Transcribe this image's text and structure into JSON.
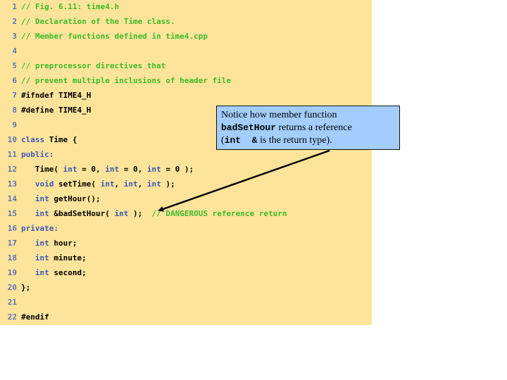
{
  "code_listing": {
    "lines": [
      {
        "n": "1",
        "parts": [
          {
            "t": "// Fig. 6.11: time4.h",
            "c": "cm"
          }
        ]
      },
      {
        "n": "2",
        "parts": [
          {
            "t": "// Declaration of the Time class.",
            "c": "cm"
          }
        ]
      },
      {
        "n": "3",
        "parts": [
          {
            "t": "// Member functions defined in time4.cpp",
            "c": "cm"
          }
        ]
      },
      {
        "n": "4",
        "parts": []
      },
      {
        "n": "5",
        "parts": [
          {
            "t": "// preprocessor directives that",
            "c": "cm"
          }
        ]
      },
      {
        "n": "6",
        "parts": [
          {
            "t": "// prevent multiple inclusions of header file",
            "c": "cm"
          }
        ]
      },
      {
        "n": "7",
        "parts": [
          {
            "t": "#ifndef TIME4_H",
            "c": "tx"
          }
        ]
      },
      {
        "n": "8",
        "parts": [
          {
            "t": "#define TIME4_H",
            "c": "tx"
          }
        ]
      },
      {
        "n": "9",
        "parts": []
      },
      {
        "n": "10",
        "parts": [
          {
            "t": "class",
            "c": "kw"
          },
          {
            "t": " Time {",
            "c": "tx"
          }
        ]
      },
      {
        "n": "11",
        "parts": [
          {
            "t": "public:",
            "c": "kw"
          }
        ]
      },
      {
        "n": "12",
        "parts": [
          {
            "t": "   Time( ",
            "c": "tx"
          },
          {
            "t": "int",
            "c": "kw"
          },
          {
            "t": " = 0, ",
            "c": "tx"
          },
          {
            "t": "int",
            "c": "kw"
          },
          {
            "t": " = 0, ",
            "c": "tx"
          },
          {
            "t": "int",
            "c": "kw"
          },
          {
            "t": " = 0 );",
            "c": "tx"
          }
        ]
      },
      {
        "n": "13",
        "parts": [
          {
            "t": "   ",
            "c": "tx"
          },
          {
            "t": "void",
            "c": "kw"
          },
          {
            "t": " setTime( ",
            "c": "tx"
          },
          {
            "t": "int",
            "c": "kw"
          },
          {
            "t": ", ",
            "c": "tx"
          },
          {
            "t": "int",
            "c": "kw"
          },
          {
            "t": ", ",
            "c": "tx"
          },
          {
            "t": "int",
            "c": "kw"
          },
          {
            "t": " );",
            "c": "tx"
          }
        ]
      },
      {
        "n": "14",
        "parts": [
          {
            "t": "   ",
            "c": "tx"
          },
          {
            "t": "int",
            "c": "kw"
          },
          {
            "t": " getHour();",
            "c": "tx"
          }
        ]
      },
      {
        "n": "15",
        "parts": [
          {
            "t": "   ",
            "c": "tx"
          },
          {
            "t": "int",
            "c": "kw"
          },
          {
            "t": " &badSetHour( ",
            "c": "tx"
          },
          {
            "t": "int",
            "c": "kw"
          },
          {
            "t": " );  ",
            "c": "tx"
          },
          {
            "t": "// DANGEROUS reference return",
            "c": "cm"
          }
        ]
      },
      {
        "n": "16",
        "parts": [
          {
            "t": "private:",
            "c": "kw"
          }
        ]
      },
      {
        "n": "17",
        "parts": [
          {
            "t": "   ",
            "c": "tx"
          },
          {
            "t": "int",
            "c": "kw"
          },
          {
            "t": " hour;",
            "c": "tx"
          }
        ]
      },
      {
        "n": "18",
        "parts": [
          {
            "t": "   ",
            "c": "tx"
          },
          {
            "t": "int",
            "c": "kw"
          },
          {
            "t": " minute;",
            "c": "tx"
          }
        ]
      },
      {
        "n": "19",
        "parts": [
          {
            "t": "   ",
            "c": "tx"
          },
          {
            "t": "int",
            "c": "kw"
          },
          {
            "t": " second;",
            "c": "tx"
          }
        ]
      },
      {
        "n": "20",
        "parts": [
          {
            "t": "};",
            "c": "tx"
          }
        ]
      },
      {
        "n": "21",
        "parts": []
      },
      {
        "n": "22",
        "parts": [
          {
            "t": "#endif",
            "c": "tx"
          }
        ]
      }
    ]
  },
  "callout": {
    "line1": "Notice how member function",
    "code1": "badSetHour",
    "text2": " returns a reference",
    "open_paren": "(",
    "code2": "int  &",
    "text3": " is the return type)."
  },
  "colors": {
    "panel_bg": "#fee49a",
    "comment": "#3dba2a",
    "keyword": "#3a56b8",
    "line_number": "#5b73b8",
    "callout_bg": "#a3cdfd"
  }
}
